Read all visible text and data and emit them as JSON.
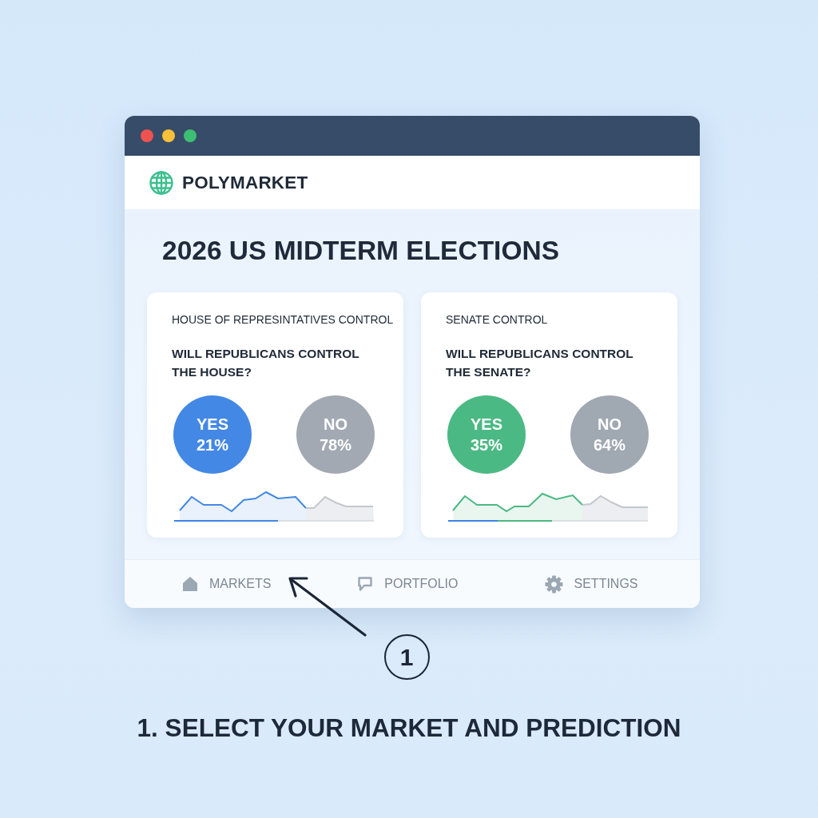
{
  "app": {
    "brand": "POLYMARKET"
  },
  "page": {
    "title": "2026 US MIDTERM ELECTIONS"
  },
  "markets": [
    {
      "category": "HOUSE OF REPRESINTATIVES CONTROL",
      "question": "WILL REPUBLICANS CONTROL THE HOUSE?",
      "options": [
        {
          "label": "YES",
          "percent": "21%",
          "color": "#4388e4"
        },
        {
          "label": "NO",
          "percent": "78%",
          "color": "#a2a9b2"
        }
      ]
    },
    {
      "category": "SENATE CONTROL",
      "question": "WILL REPUBLICANS CONTROL THE SENATE?",
      "options": [
        {
          "label": "YES",
          "percent": "35%",
          "color": "#4bb983"
        },
        {
          "label": "NO",
          "percent": "64%",
          "color": "#a0a8b1"
        }
      ]
    }
  ],
  "nav": [
    {
      "kind": "home",
      "label": "MARKETS",
      "selected": false
    },
    {
      "kind": "bubble",
      "label": "PORTFOLIO",
      "selected": false
    },
    {
      "kind": "gear",
      "label": "SETTINGS",
      "selected": false
    }
  ],
  "step": {
    "number": "1",
    "caption": "1. SELECT YOUR MARKET AND PREDICTION"
  }
}
